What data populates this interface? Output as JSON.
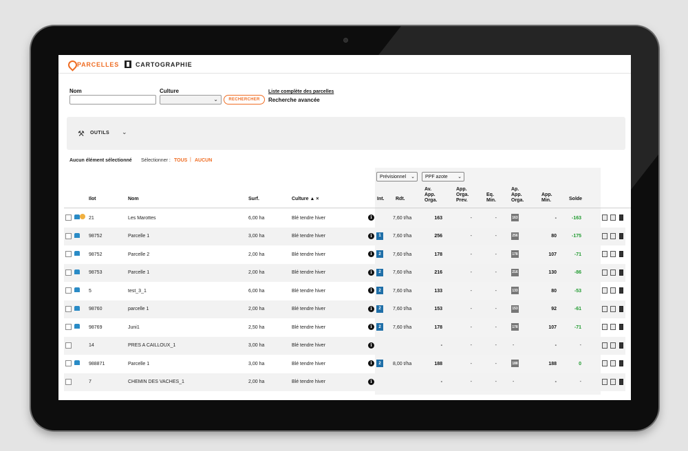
{
  "tabs": [
    {
      "label": "PARCELLES",
      "active": true,
      "icon": "pin-icon"
    },
    {
      "label": "CARTOGRAPHIE",
      "active": false,
      "icon": "map-icon"
    }
  ],
  "search": {
    "nom_label": "Nom",
    "nom_value": "",
    "culture_label": "Culture",
    "culture_value": "",
    "search_button": "RECHERCHER",
    "list_link": "Liste complète des parcelles",
    "advanced_link": "Recherche avancée"
  },
  "toolbar": {
    "tools_label": "OUTILS"
  },
  "selection": {
    "info": "Aucun élément sélectionné",
    "select_label": "Sélectionner :",
    "all": "TOUS",
    "separator": "|",
    "none": "AUCUN"
  },
  "dropdowns": {
    "mode": "Prévisionnel",
    "ppf": "PPF azote"
  },
  "columns": {
    "ilot": "Ilot",
    "nom": "Nom",
    "surf": "Surf.",
    "culture": "Culture ▲ ×",
    "int": "Int.",
    "rdt": "Rdt.",
    "av_app_orga": [
      "Av.",
      "App.",
      "Orga."
    ],
    "app_orga_prev": [
      "App.",
      "Orga.",
      "Prev."
    ],
    "eq_min": [
      "Eq.",
      "Min."
    ],
    "ap_app_orga": [
      "Ap.",
      "App.",
      "Orga."
    ],
    "app_min": [
      "App.",
      "Min."
    ],
    "solde": "Solde"
  },
  "rows": [
    {
      "ilot": "21",
      "nom": "Les Marottes",
      "surf": "6,00 ha",
      "culture": "Blé tendre hiver",
      "int": "",
      "rdt": "7,60 t/ha",
      "av": "163",
      "prev": "-",
      "eq": "-",
      "ap": "163",
      "min": "-",
      "solde": "-163",
      "icons": 2
    },
    {
      "ilot": "98752",
      "nom": "Parcelle 1",
      "surf": "3,00 ha",
      "culture": "Blé tendre hiver",
      "int": "1",
      "rdt": "7,60 t/ha",
      "av": "256",
      "prev": "-",
      "eq": "-",
      "ap": "256",
      "min": "80",
      "solde": "-175",
      "icons": 1
    },
    {
      "ilot": "98752",
      "nom": "Parcelle 2",
      "surf": "2,00 ha",
      "culture": "Blé tendre hiver",
      "int": "2",
      "rdt": "7,60 t/ha",
      "av": "178",
      "prev": "-",
      "eq": "-",
      "ap": "178",
      "min": "107",
      "solde": "-71",
      "icons": 1
    },
    {
      "ilot": "98753",
      "nom": "Parcelle 1",
      "surf": "2,00 ha",
      "culture": "Blé tendre hiver",
      "int": "2",
      "rdt": "7,60 t/ha",
      "av": "216",
      "prev": "-",
      "eq": "-",
      "ap": "216",
      "min": "130",
      "solde": "-86",
      "icons": 1
    },
    {
      "ilot": "5",
      "nom": "test_3_1",
      "surf": "6,00 ha",
      "culture": "Blé tendre hiver",
      "int": "2",
      "rdt": "7,60 t/ha",
      "av": "133",
      "prev": "-",
      "eq": "-",
      "ap": "133",
      "min": "80",
      "solde": "-53",
      "icons": 1
    },
    {
      "ilot": "98760",
      "nom": "parcelle 1",
      "surf": "2,00 ha",
      "culture": "Blé tendre hiver",
      "int": "2",
      "rdt": "7,60 t/ha",
      "av": "153",
      "prev": "-",
      "eq": "-",
      "ap": "153",
      "min": "92",
      "solde": "-61",
      "icons": 1
    },
    {
      "ilot": "98769",
      "nom": "Juni1",
      "surf": "2,50 ha",
      "culture": "Blé tendre hiver",
      "int": "2",
      "rdt": "7,60 t/ha",
      "av": "178",
      "prev": "-",
      "eq": "-",
      "ap": "178",
      "min": "107",
      "solde": "-71",
      "icons": 1
    },
    {
      "ilot": "14",
      "nom": "PRES A CAILLOUX_1",
      "surf": "3,00 ha",
      "culture": "Blé tendre hiver",
      "int": "",
      "rdt": "",
      "av": "-",
      "prev": "-",
      "eq": "-",
      "ap": "-",
      "min": "-",
      "solde": "-",
      "icons": 0
    },
    {
      "ilot": "988871",
      "nom": "Parcelle 1",
      "surf": "3,00 ha",
      "culture": "Blé tendre hiver",
      "int": "2",
      "rdt": "8,00 t/ha",
      "av": "188",
      "prev": "-",
      "eq": "-",
      "ap": "188",
      "min": "188",
      "solde": "0",
      "icons": 1
    },
    {
      "ilot": "7",
      "nom": "CHEMIN DES VACHES_1",
      "surf": "2,00 ha",
      "culture": "Blé tendre hiver",
      "int": "",
      "rdt": "",
      "av": "-",
      "prev": "-",
      "eq": "-",
      "ap": "-",
      "min": "-",
      "solde": "-",
      "icons": 0
    }
  ]
}
